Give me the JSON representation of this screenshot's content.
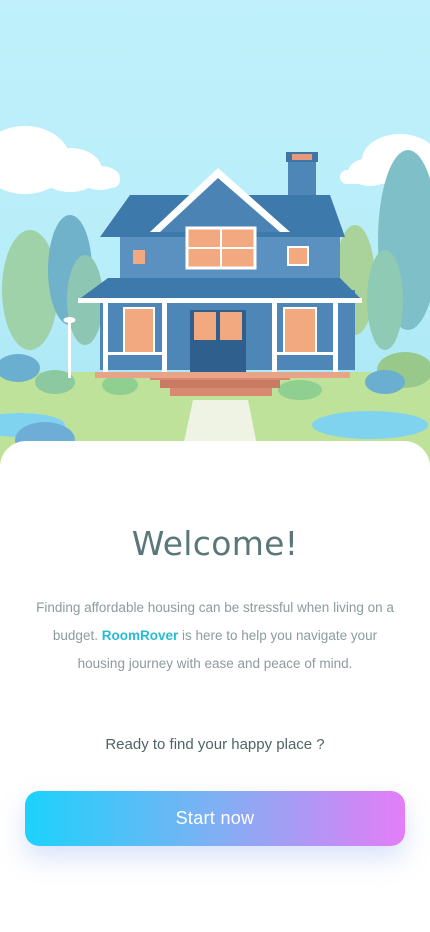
{
  "onboarding": {
    "title": "Welcome!",
    "intro_before_brand": "Finding affordable housing can be stressful when living on a budget. ",
    "brand_name": "RoomRover",
    "intro_after_brand": " is here to help you navigate your housing journey with ease and peace of mind.",
    "prompt": "Ready to find your happy place ?",
    "start_button_label": "Start now"
  },
  "illustration": {
    "subject": "house-illustration"
  },
  "colors": {
    "brand": "#27bcd6",
    "title": "#5c777a",
    "body_text": "#8c9b9d",
    "button_gradient_start": "#1cd2fc",
    "button_gradient_end": "#e47df7"
  }
}
